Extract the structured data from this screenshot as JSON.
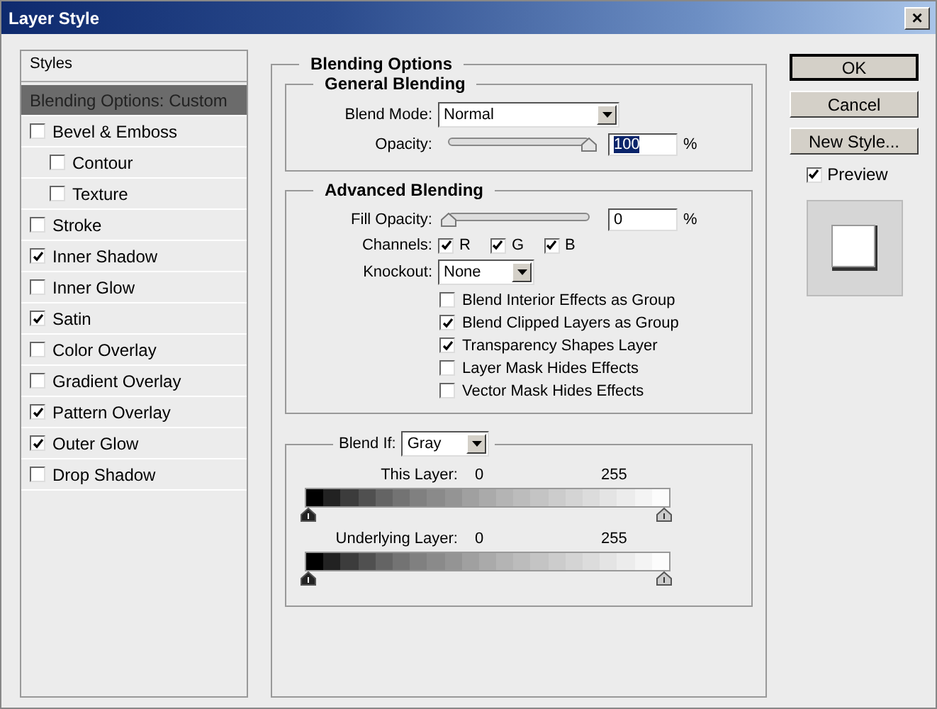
{
  "window": {
    "title": "Layer Style",
    "close": "×"
  },
  "styles_panel": {
    "header": "Styles",
    "items": [
      {
        "label": "Blending Options: Custom",
        "kind": "plain",
        "selected": true
      },
      {
        "label": "Bevel & Emboss",
        "kind": "check",
        "checked": false,
        "selected": false,
        "children": [
          {
            "label": "Contour",
            "kind": "check",
            "checked": false,
            "selected": false
          },
          {
            "label": "Texture",
            "kind": "check",
            "checked": false,
            "selected": false
          }
        ]
      },
      {
        "label": "Stroke",
        "kind": "check",
        "checked": false,
        "selected": false
      },
      {
        "label": "Inner Shadow",
        "kind": "check",
        "checked": true,
        "selected": false
      },
      {
        "label": "Inner Glow",
        "kind": "check",
        "checked": false,
        "selected": false
      },
      {
        "label": "Satin",
        "kind": "check",
        "checked": true,
        "selected": false
      },
      {
        "label": "Color Overlay",
        "kind": "check",
        "checked": false,
        "selected": false
      },
      {
        "label": "Gradient Overlay",
        "kind": "check",
        "checked": false,
        "selected": false
      },
      {
        "label": "Pattern Overlay",
        "kind": "check",
        "checked": true,
        "selected": false
      },
      {
        "label": "Outer Glow",
        "kind": "check",
        "checked": true,
        "selected": false
      },
      {
        "label": "Drop Shadow",
        "kind": "check",
        "checked": false,
        "selected": false
      }
    ]
  },
  "blending_options": {
    "title": "Blending Options",
    "general": {
      "title": "General Blending",
      "blend_mode": {
        "label": "Blend Mode:",
        "value": "Normal"
      },
      "opacity": {
        "label": "Opacity:",
        "level": 1,
        "value": "100",
        "value_highlighted": true,
        "unit": "%"
      }
    },
    "advanced": {
      "title": "Advanced Blending",
      "fill_opacity": {
        "label": "Fill Opacity:",
        "level": 0,
        "value": "0",
        "value_highlighted": false,
        "unit": "%"
      },
      "channels": {
        "label": "Channels:",
        "items": [
          {
            "label": "R",
            "checked": true
          },
          {
            "label": "G",
            "checked": true
          },
          {
            "label": "B",
            "checked": true
          }
        ]
      },
      "knockout": {
        "label": "Knockout:",
        "value": "None"
      },
      "options": [
        {
          "label": "Blend Interior Effects as Group",
          "checked": false
        },
        {
          "label": "Blend Clipped Layers as Group",
          "checked": true
        },
        {
          "label": "Transparency Shapes Layer",
          "checked": true
        },
        {
          "label": "Layer Mask Hides Effects",
          "checked": false
        },
        {
          "label": "Vector Mask Hides Effects",
          "checked": false
        }
      ]
    },
    "blend_if": {
      "label": "Blend If:",
      "value": "Gray",
      "ranges": [
        {
          "label": "This Layer:",
          "low": "0",
          "high": "255"
        },
        {
          "label": "Underlying Layer:",
          "low": "0",
          "high": "255"
        }
      ]
    }
  },
  "buttons": [
    {
      "label": "OK",
      "default": true
    },
    {
      "label": "Cancel",
      "default": false
    },
    {
      "label": "New Style...",
      "default": false
    }
  ],
  "preview": {
    "label": "Preview",
    "checked": true
  }
}
